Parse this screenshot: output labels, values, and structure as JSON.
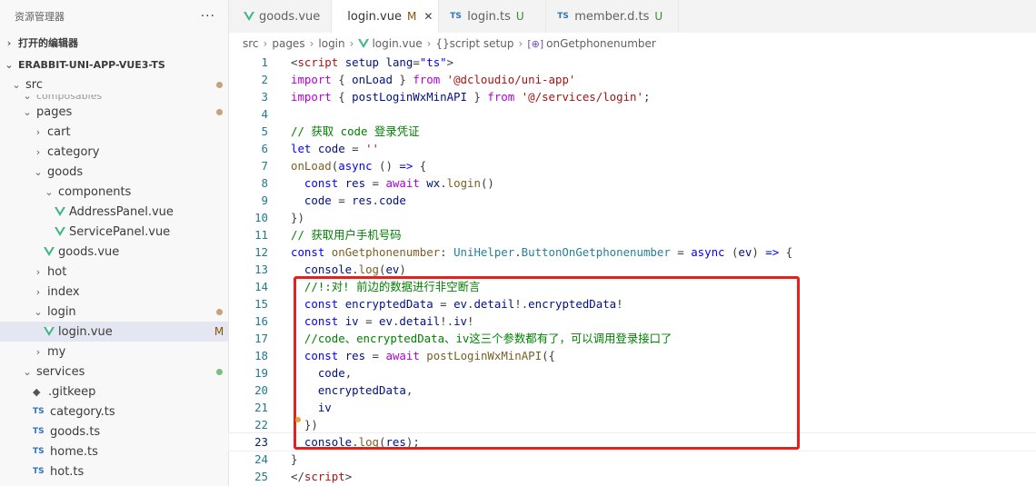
{
  "explorer": {
    "title": "资源管理器",
    "more_icon": "···",
    "open_editors_label": "打开的编辑器",
    "project_label": "ERABBIT-UNI-APP-VUE3-TS",
    "tree": [
      {
        "label": "src",
        "kind": "folder-open",
        "indent": 0,
        "mark": "dot-brown"
      },
      {
        "label": "composables",
        "kind": "folder-partial",
        "indent": 1,
        "mark": ""
      },
      {
        "label": "pages",
        "kind": "folder-open",
        "indent": 1,
        "mark": "dot-brown"
      },
      {
        "label": "cart",
        "kind": "folder",
        "indent": 2,
        "mark": ""
      },
      {
        "label": "category",
        "kind": "folder",
        "indent": 2,
        "mark": ""
      },
      {
        "label": "goods",
        "kind": "folder-open",
        "indent": 2,
        "mark": ""
      },
      {
        "label": "components",
        "kind": "folder-open",
        "indent": 3,
        "mark": ""
      },
      {
        "label": "AddressPanel.vue",
        "kind": "vue",
        "indent": 4,
        "mark": ""
      },
      {
        "label": "ServicePanel.vue",
        "kind": "vue",
        "indent": 4,
        "mark": ""
      },
      {
        "label": "goods.vue",
        "kind": "vue",
        "indent": 3,
        "mark": ""
      },
      {
        "label": "hot",
        "kind": "folder",
        "indent": 2,
        "mark": ""
      },
      {
        "label": "index",
        "kind": "folder",
        "indent": 2,
        "mark": ""
      },
      {
        "label": "login",
        "kind": "folder-open",
        "indent": 2,
        "mark": "dot-brown"
      },
      {
        "label": "login.vue",
        "kind": "vue",
        "indent": 3,
        "mark": "M",
        "selected": true
      },
      {
        "label": "my",
        "kind": "folder",
        "indent": 2,
        "mark": ""
      },
      {
        "label": "services",
        "kind": "folder-open",
        "indent": 1,
        "mark": "dot-green"
      },
      {
        "label": ".gitkeep",
        "kind": "git",
        "indent": 2,
        "mark": ""
      },
      {
        "label": "category.ts",
        "kind": "ts",
        "indent": 2,
        "mark": ""
      },
      {
        "label": "goods.ts",
        "kind": "ts",
        "indent": 2,
        "mark": ""
      },
      {
        "label": "home.ts",
        "kind": "ts",
        "indent": 2,
        "mark": ""
      },
      {
        "label": "hot.ts",
        "kind": "ts",
        "indent": 2,
        "mark": ""
      }
    ]
  },
  "tabs": [
    {
      "label": "goods.vue",
      "icon": "vue",
      "status": "",
      "active": false
    },
    {
      "label": "login.vue",
      "icon": "vue",
      "status": "M",
      "active": true,
      "close": "✕"
    },
    {
      "label": "login.ts",
      "icon": "ts",
      "status": "U",
      "active": false
    },
    {
      "label": "member.d.ts",
      "icon": "ts",
      "status": "U",
      "active": false
    }
  ],
  "breadcrumb": {
    "parts": [
      "src",
      "pages",
      "login",
      "login.vue",
      "script setup",
      "onGetphonenumber"
    ],
    "script_prefix": "{}",
    "symbol_prefix": "[⊕]"
  },
  "colors": {
    "highlight_box": "#e5211e",
    "vue_green": "#41b883",
    "ts_blue": "#2f74c0"
  },
  "code": {
    "current_line": 23,
    "lines": [
      {
        "n": "1",
        "tokens": [
          [
            "<",
            "pun"
          ],
          [
            "script",
            "str"
          ],
          [
            " ",
            "pun"
          ],
          [
            "setup",
            "var"
          ],
          [
            " ",
            "pun"
          ],
          [
            "lang",
            "var"
          ],
          [
            "=",
            "pun"
          ],
          [
            "\"ts\"",
            "kw"
          ],
          [
            ">",
            "pun"
          ]
        ]
      },
      {
        "n": "2",
        "tokens": [
          [
            "import",
            "kw2"
          ],
          [
            " { ",
            "pun"
          ],
          [
            "onLoad",
            "var"
          ],
          [
            " } ",
            "pun"
          ],
          [
            "from",
            "kw2"
          ],
          [
            " ",
            "pun"
          ],
          [
            "'@dcloudio/uni-app'",
            "str"
          ]
        ]
      },
      {
        "n": "3",
        "tokens": [
          [
            "import",
            "kw2"
          ],
          [
            " { ",
            "pun"
          ],
          [
            "postLoginWxMinAPI",
            "var"
          ],
          [
            " } ",
            "pun"
          ],
          [
            "from",
            "kw2"
          ],
          [
            " ",
            "pun"
          ],
          [
            "'@/services/login'",
            "str"
          ],
          [
            ";",
            "pun"
          ]
        ]
      },
      {
        "n": "4",
        "tokens": []
      },
      {
        "n": "5",
        "tokens": [
          [
            "// 获取 code 登录凭证",
            "cmt"
          ]
        ]
      },
      {
        "n": "6",
        "tokens": [
          [
            "let",
            "kw"
          ],
          [
            " ",
            "pun"
          ],
          [
            "code",
            "var"
          ],
          [
            " = ",
            "pun"
          ],
          [
            "''",
            "str"
          ]
        ]
      },
      {
        "n": "7",
        "tokens": [
          [
            "onLoad",
            "fn"
          ],
          [
            "(",
            "pun"
          ],
          [
            "async",
            "kw"
          ],
          [
            " () ",
            "pun"
          ],
          [
            "=>",
            "kw"
          ],
          [
            " {",
            "pun"
          ]
        ]
      },
      {
        "n": "8",
        "tokens": [
          [
            "  ",
            "pun"
          ],
          [
            "const",
            "kw"
          ],
          [
            " ",
            "pun"
          ],
          [
            "res",
            "var"
          ],
          [
            " = ",
            "pun"
          ],
          [
            "await",
            "kw2"
          ],
          [
            " ",
            "pun"
          ],
          [
            "wx",
            "var"
          ],
          [
            ".",
            "pun"
          ],
          [
            "login",
            "fn"
          ],
          [
            "()",
            "pun"
          ]
        ]
      },
      {
        "n": "9",
        "tokens": [
          [
            "  ",
            "pun"
          ],
          [
            "code",
            "var"
          ],
          [
            " = ",
            "pun"
          ],
          [
            "res",
            "var"
          ],
          [
            ".",
            "pun"
          ],
          [
            "code",
            "var"
          ]
        ]
      },
      {
        "n": "10",
        "tokens": [
          [
            "})",
            "pun"
          ]
        ]
      },
      {
        "n": "11",
        "tokens": [
          [
            "// 获取用户手机号码",
            "cmt"
          ]
        ]
      },
      {
        "n": "12",
        "tokens": [
          [
            "const",
            "kw"
          ],
          [
            " ",
            "pun"
          ],
          [
            "onGetphonenumber",
            "fn"
          ],
          [
            ": ",
            "pun"
          ],
          [
            "UniHelper",
            "typ"
          ],
          [
            ".",
            "pun"
          ],
          [
            "ButtonOnGetphonenumber",
            "typ"
          ],
          [
            " = ",
            "pun"
          ],
          [
            "async",
            "kw"
          ],
          [
            " (",
            "pun"
          ],
          [
            "ev",
            "var"
          ],
          [
            ") ",
            "pun"
          ],
          [
            "=>",
            "kw"
          ],
          [
            " {",
            "pun"
          ]
        ]
      },
      {
        "n": "13",
        "tokens": [
          [
            "  ",
            "pun"
          ],
          [
            "console",
            "var"
          ],
          [
            ".",
            "pun"
          ],
          [
            "log",
            "fn"
          ],
          [
            "(",
            "pun"
          ],
          [
            "ev",
            "var"
          ],
          [
            ")",
            "pun"
          ]
        ]
      },
      {
        "n": "14",
        "tokens": [
          [
            "  ",
            "pun"
          ],
          [
            "//!:对! 前边的数据进行非空断言",
            "cmt"
          ]
        ]
      },
      {
        "n": "15",
        "tokens": [
          [
            "  ",
            "pun"
          ],
          [
            "const",
            "kw"
          ],
          [
            " ",
            "pun"
          ],
          [
            "encryptedData",
            "var"
          ],
          [
            " = ",
            "pun"
          ],
          [
            "ev",
            "var"
          ],
          [
            ".",
            "pun"
          ],
          [
            "detail",
            "var"
          ],
          [
            "!.",
            "pun"
          ],
          [
            "encryptedData",
            "var"
          ],
          [
            "!",
            "pun"
          ]
        ]
      },
      {
        "n": "16",
        "tokens": [
          [
            "  ",
            "pun"
          ],
          [
            "const",
            "kw"
          ],
          [
            " ",
            "pun"
          ],
          [
            "iv",
            "var"
          ],
          [
            " = ",
            "pun"
          ],
          [
            "ev",
            "var"
          ],
          [
            ".",
            "pun"
          ],
          [
            "detail",
            "var"
          ],
          [
            "!.",
            "pun"
          ],
          [
            "iv",
            "var"
          ],
          [
            "!",
            "pun"
          ]
        ]
      },
      {
        "n": "17",
        "tokens": [
          [
            "  ",
            "pun"
          ],
          [
            "//code、encryptedData、iv这三个参数都有了，可以调用登录接口了",
            "cmt"
          ]
        ]
      },
      {
        "n": "18",
        "tokens": [
          [
            "  ",
            "pun"
          ],
          [
            "const",
            "kw"
          ],
          [
            " ",
            "pun"
          ],
          [
            "res",
            "var"
          ],
          [
            " = ",
            "pun"
          ],
          [
            "await",
            "kw2"
          ],
          [
            " ",
            "pun"
          ],
          [
            "postLoginWxMinAPI",
            "fn"
          ],
          [
            "({",
            "pun"
          ]
        ]
      },
      {
        "n": "19",
        "tokens": [
          [
            "    ",
            "pun"
          ],
          [
            "code",
            "var"
          ],
          [
            ",",
            "pun"
          ]
        ]
      },
      {
        "n": "20",
        "tokens": [
          [
            "    ",
            "pun"
          ],
          [
            "encryptedData",
            "var"
          ],
          [
            ",",
            "pun"
          ]
        ]
      },
      {
        "n": "21",
        "tokens": [
          [
            "    ",
            "pun"
          ],
          [
            "iv",
            "var"
          ]
        ]
      },
      {
        "n": "22",
        "tokens": [
          [
            "  ",
            "pun"
          ],
          [
            "})",
            "pun"
          ]
        ]
      },
      {
        "n": "23",
        "tokens": [
          [
            "  ",
            "pun"
          ],
          [
            "console",
            "var"
          ],
          [
            ".",
            "pun"
          ],
          [
            "log",
            "fn"
          ],
          [
            "(",
            "pun"
          ],
          [
            "res",
            "var"
          ],
          [
            ");",
            "pun"
          ]
        ]
      },
      {
        "n": "24",
        "tokens": [
          [
            "}",
            "pun"
          ]
        ]
      },
      {
        "n": "25",
        "tokens": [
          [
            "</",
            "pun"
          ],
          [
            "script",
            "str"
          ],
          [
            ">",
            "pun"
          ]
        ]
      }
    ]
  }
}
